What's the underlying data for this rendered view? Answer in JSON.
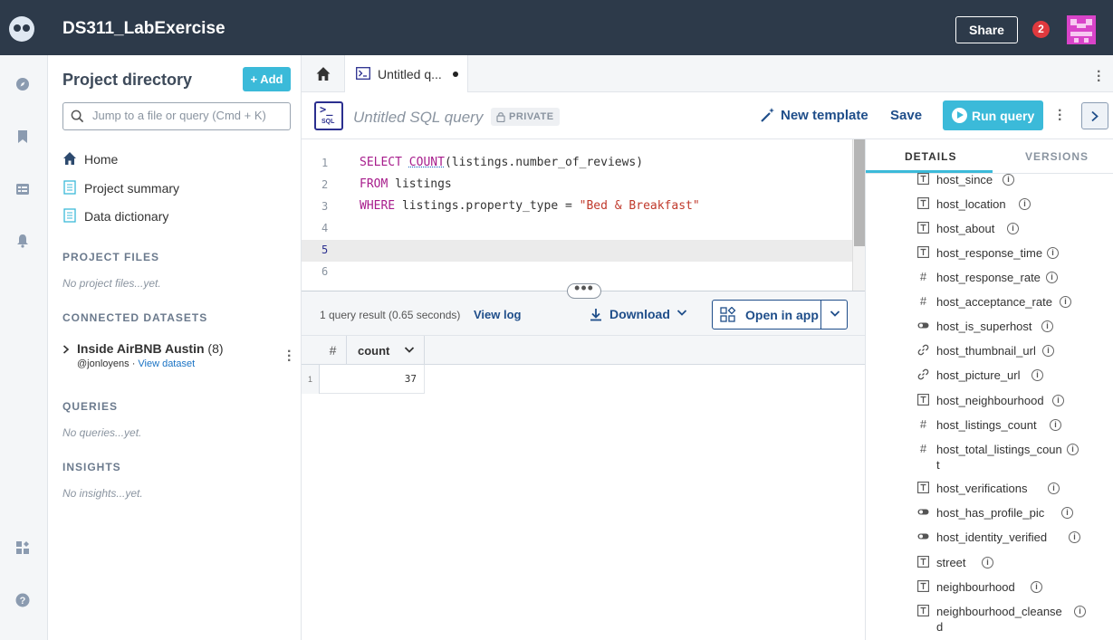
{
  "header": {
    "title": "DS311_LabExercise",
    "share_label": "Share",
    "notification_count": "2"
  },
  "sidebar": {
    "title": "Project directory",
    "add_label": "Add",
    "search_placeholder": "Jump to a file or query (Cmd + K)",
    "nav": [
      {
        "label": "Home",
        "icon": "home-icon"
      },
      {
        "label": "Project summary",
        "icon": "document-icon"
      },
      {
        "label": "Data dictionary",
        "icon": "document-icon"
      }
    ],
    "sections": {
      "project_files": {
        "title": "PROJECT FILES",
        "empty": "No project files...yet."
      },
      "connected_datasets": {
        "title": "CONNECTED DATASETS"
      },
      "queries": {
        "title": "QUERIES",
        "empty": "No queries...yet."
      },
      "insights": {
        "title": "INSIGHTS",
        "empty": "No insights...yet."
      }
    },
    "dataset": {
      "name": "Inside AirBNB Austin",
      "count": "(8)",
      "owner": "@jonloyens ·",
      "view_link": "View dataset"
    }
  },
  "tabs": {
    "query_tab_label": "Untitled q..."
  },
  "query": {
    "badge_text": "SQL",
    "title": "Untitled SQL query",
    "privacy": "PRIVATE",
    "new_template_label": "New template",
    "save_label": "Save",
    "run_label": "Run query"
  },
  "editor": {
    "line_numbers": [
      "1",
      "2",
      "3",
      "4",
      "5"
    ],
    "active_line": 5,
    "line1": {
      "kw": "SELECT",
      "fn": "COUNT",
      "rest": "(listings.number_of_reviews)"
    },
    "line2": {
      "kw": "FROM",
      "rest": " listings"
    },
    "line3": {
      "kw": "WHERE",
      "rest": " listings.property_type = ",
      "str": "\"Bed & Breakfast\""
    }
  },
  "results": {
    "info": "1 query result  (0.65 seconds)",
    "view_log": "View log",
    "download_label": "Download",
    "open_in_app_label": "Open in app",
    "index_header": "#",
    "columns": [
      "count"
    ],
    "rows": [
      {
        "index": "1",
        "values": [
          "37"
        ]
      }
    ]
  },
  "details_panel": {
    "tabs": [
      "DETAILS",
      "VERSIONS"
    ],
    "active_tab": "DETAILS",
    "fields": [
      {
        "name": "host_since",
        "type": "text-icon"
      },
      {
        "name": "host_location",
        "type": "text-icon"
      },
      {
        "name": "host_about",
        "type": "text-icon"
      },
      {
        "name": "host_response_time",
        "type": "text-icon"
      },
      {
        "name": "host_response_rate",
        "type": "number-icon"
      },
      {
        "name": "host_acceptance_rate",
        "type": "number-icon"
      },
      {
        "name": "host_is_superhost",
        "type": "toggle-icon"
      },
      {
        "name": "host_thumbnail_url",
        "type": "link-icon"
      },
      {
        "name": "host_picture_url",
        "type": "link-icon"
      },
      {
        "name": "host_neighbourhood",
        "type": "text-icon"
      },
      {
        "name": "host_listings_count",
        "type": "number-icon"
      },
      {
        "name": "host_total_listings_count",
        "type": "number-icon"
      },
      {
        "name": "host_verifications",
        "type": "text-icon"
      },
      {
        "name": "host_has_profile_pic",
        "type": "toggle-icon"
      },
      {
        "name": "host_identity_verified",
        "type": "toggle-icon"
      },
      {
        "name": "street",
        "type": "text-icon"
      },
      {
        "name": "neighbourhood",
        "type": "text-icon"
      },
      {
        "name": "neighbourhood_cleansed",
        "type": "text-icon"
      }
    ]
  },
  "colors": {
    "topbar": "#2d3a4a",
    "accent": "#3bbad9",
    "link": "#1f4e8a",
    "badge": "#e0393e"
  }
}
